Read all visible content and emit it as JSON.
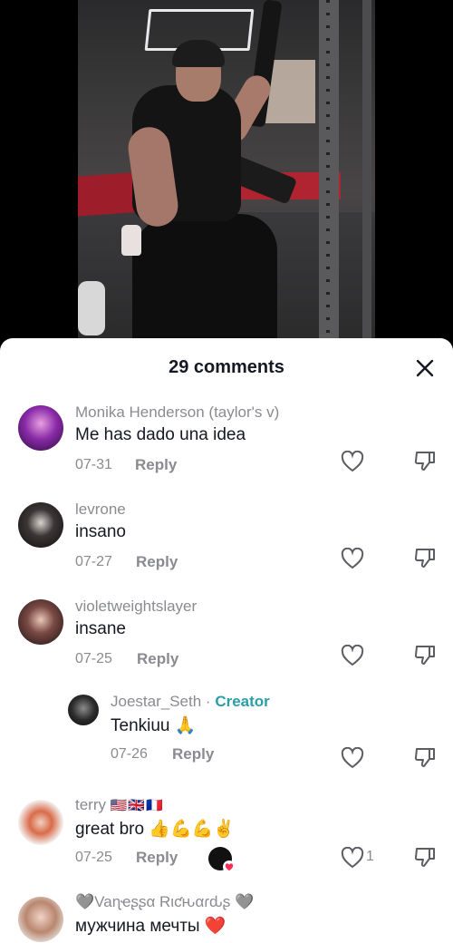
{
  "video": {
    "description_icon": "video-frame"
  },
  "comments_sheet": {
    "title": "29 comments",
    "close_icon": "close-icon"
  },
  "comments": [
    {
      "username": "Monika Henderson (taylor's v)",
      "text": "Me has dado una idea",
      "date": "07-31",
      "reply_label": "Reply"
    },
    {
      "username": "levrone",
      "text": "insano",
      "date": "07-27",
      "reply_label": "Reply"
    },
    {
      "username": "violetweightslayer",
      "text": "insane",
      "date": "07-25",
      "reply_label": "Reply"
    },
    {
      "username": "Joestar_Seth",
      "separator": "·",
      "badge": "Creator",
      "text": "Tenkiuu 🙏",
      "date": "07-26",
      "reply_label": "Reply"
    },
    {
      "username": "terry",
      "flags": "🇺🇸🇬🇧🇫🇷",
      "text": "great bro 👍💪💪✌️",
      "date": "07-25",
      "reply_label": "Reply",
      "like_count": "1"
    },
    {
      "username": "🩶Vaɳҽʂʂα Rιƈԋαɾԃʂ 🩶",
      "text": "мужчина мечты ❤️"
    }
  ],
  "colors": {
    "creator_tag": "#2a9fa8",
    "muted_text": "#8a8b91",
    "primary_text": "#161823"
  }
}
